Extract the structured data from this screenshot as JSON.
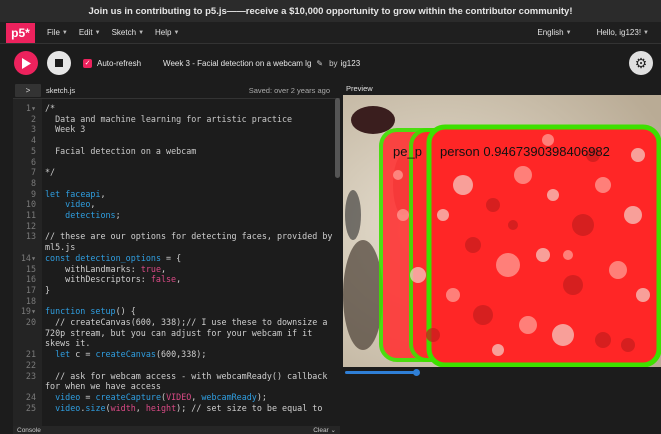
{
  "banner": {
    "text": "Join us in contributing to p5.js——receive a $10,000 opportunity to grow within the contributor community!"
  },
  "nav": {
    "logo": "p5*",
    "menus": [
      "File",
      "Edit",
      "Sketch",
      "Help"
    ],
    "language": "English",
    "greeting": "Hello, ig123!"
  },
  "toolbar": {
    "auto_refresh_label": "Auto-refresh",
    "sketch_name": "Week 3 - Facial detection on a webcam lg",
    "by_label": "by",
    "author": "ig123"
  },
  "editor": {
    "filename": "sketch.js",
    "saved": "Saved: over 2 years ago",
    "lines": [
      {
        "n": "1",
        "fold": true,
        "html": "<span class=\"cm\">/*</span>"
      },
      {
        "n": "2",
        "html": "<span class=\"cm\">  Data and machine learning for artistic practice</span>"
      },
      {
        "n": "3",
        "html": "<span class=\"cm\">  Week 3</span>"
      },
      {
        "n": "4",
        "html": ""
      },
      {
        "n": "5",
        "html": "<span class=\"cm\">  Facial detection on a webcam</span>"
      },
      {
        "n": "6",
        "html": ""
      },
      {
        "n": "7",
        "html": "<span class=\"cm\">*/</span>"
      },
      {
        "n": "8",
        "html": ""
      },
      {
        "n": "9",
        "html": "<span class=\"kw\">let</span> <span class=\"fn\">faceapi</span>,"
      },
      {
        "n": "10",
        "html": "    <span class=\"fn\">video</span>,"
      },
      {
        "n": "11",
        "html": "    <span class=\"fn\">detections</span>;"
      },
      {
        "n": "12",
        "html": ""
      },
      {
        "n": "13",
        "html": "// these are our options for detecting faces, provided by ml5.js"
      },
      {
        "n": "14",
        "fold": true,
        "html": "<span class=\"kw\">const</span> <span class=\"fn\">detection_options</span> = {"
      },
      {
        "n": "15",
        "html": "    withLandmarks: <span class=\"pr\">true</span>,"
      },
      {
        "n": "16",
        "html": "    withDescriptors: <span class=\"pr\">false</span>,"
      },
      {
        "n": "17",
        "html": "}"
      },
      {
        "n": "18",
        "html": ""
      },
      {
        "n": "19",
        "fold": true,
        "html": "<span class=\"kw\">function</span> <span class=\"fn\">setup</span>() {"
      },
      {
        "n": "20",
        "html": "  // createCanvas(600, 338);// I use these to downsize a 720p stream, but you can adjust for your webcam if it skews it."
      },
      {
        "n": "21",
        "html": "  <span class=\"kw\">let</span> c = <span class=\"fn\">createCanvas</span>(600,338);"
      },
      {
        "n": "22",
        "html": ""
      },
      {
        "n": "23",
        "html": "  // ask for webcam access - with webcamReady() callback for when we have access"
      },
      {
        "n": "24",
        "html": "  <span class=\"fn\">video</span> = <span class=\"fn\">createCapture</span>(<span class=\"pr\">VIDEO</span>, <span class=\"fn\">webcamReady</span>);"
      },
      {
        "n": "25",
        "html": "  <span class=\"fn\">video</span>.<span class=\"fn\">size</span>(<span class=\"pr\">width</span>, <span class=\"pr\">height</span>); // set size to be equal to"
      }
    ]
  },
  "console": {
    "label": "Console",
    "clear": "Clear"
  },
  "preview": {
    "label": "Preview",
    "detection_label_1": "pe_p",
    "detection_label_2": "person 0.9467390398406982"
  },
  "colors": {
    "accent": "#ed225d",
    "box": "#3ee000",
    "fill": "#ff2a2a"
  }
}
